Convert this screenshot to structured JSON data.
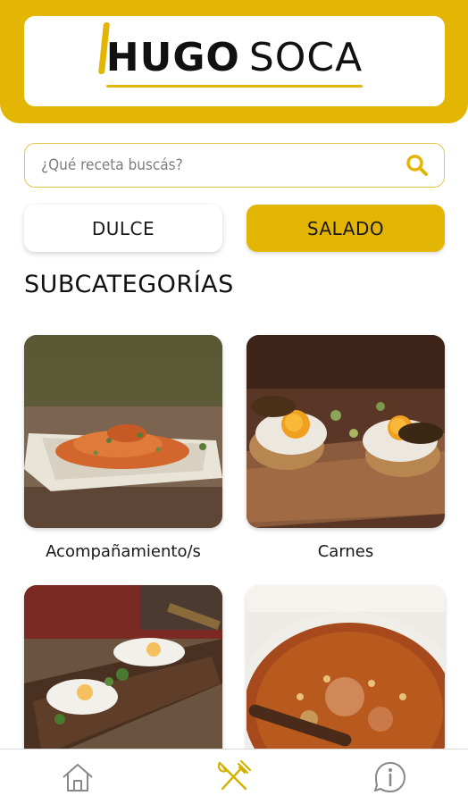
{
  "header": {
    "logo_part1": "HUGO",
    "logo_part2": "SOCA",
    "brand_color": "#e3b505"
  },
  "search": {
    "placeholder": "¿Qué receta buscás?",
    "icon": "search-icon"
  },
  "tabs": [
    {
      "label": "DULCE",
      "active": false
    },
    {
      "label": "SALADO",
      "active": true
    }
  ],
  "section_title": "SUBCATEGORÍAS",
  "subcategories": [
    {
      "label": "Acompañamiento/s",
      "image": "food-photo-side-dish"
    },
    {
      "label": "Carnes",
      "image": "food-photo-fried-eggs-toast"
    },
    {
      "label": "",
      "image": "food-photo-eggs-board"
    },
    {
      "label": "",
      "image": "food-photo-stew-pot"
    }
  ],
  "bottom_nav": [
    {
      "name": "home",
      "icon": "home-icon",
      "active": false
    },
    {
      "name": "recipes",
      "icon": "fork-knife-icon",
      "active": true
    },
    {
      "name": "info",
      "icon": "info-icon",
      "active": false
    }
  ]
}
